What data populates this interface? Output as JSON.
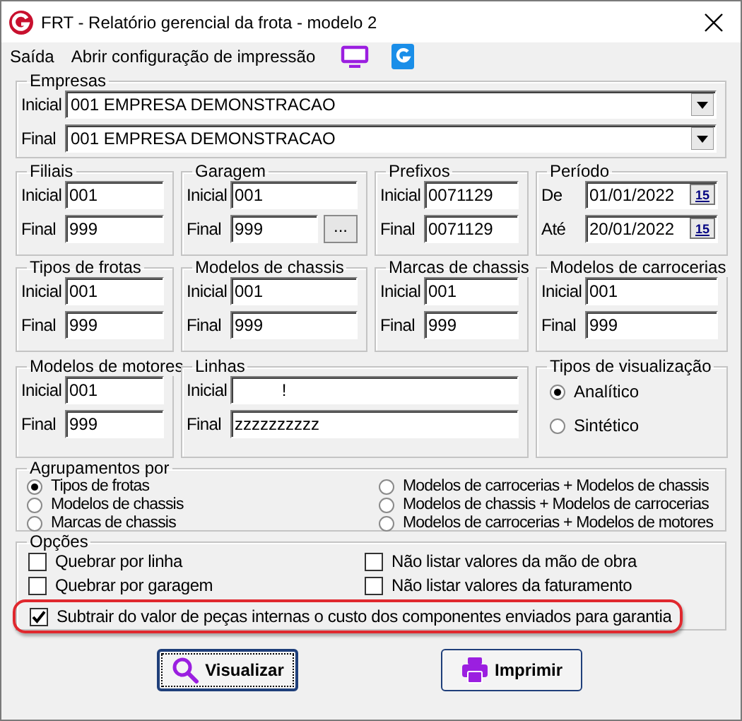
{
  "window": {
    "title": "FRT - Relatório gerencial da frota - modelo 2"
  },
  "menu": [
    {
      "label": "Saída"
    },
    {
      "label": "Abrir configuração de impressão"
    }
  ],
  "empresas": {
    "title": "Empresas",
    "rows": [
      {
        "label": "Inicial",
        "value": "001 EMPRESA DEMONSTRACAO"
      },
      {
        "label": "Final",
        "value": "001 EMPRESA DEMONSTRACAO"
      }
    ]
  },
  "filter_rows": [
    [
      {
        "title": "Filiais",
        "kind": "range",
        "rows": [
          {
            "label": "Inicial",
            "value": "001"
          },
          {
            "label": "Final",
            "value": "999"
          }
        ]
      },
      {
        "title": "Garagem",
        "kind": "range",
        "rows": [
          {
            "label": "Inicial",
            "value": "001"
          },
          {
            "label": "Final",
            "value": "999",
            "button": "..."
          }
        ]
      },
      {
        "title": "Prefixos",
        "kind": "range",
        "rows": [
          {
            "label": "Inicial",
            "value": "0071129"
          },
          {
            "label": "Final",
            "value": "0071129"
          }
        ]
      },
      {
        "title": "Período",
        "kind": "date_range",
        "rows": [
          {
            "label": "De",
            "value": "01/01/2022",
            "button": "15"
          },
          {
            "label": "Até",
            "value": "20/01/2022",
            "button": "15"
          }
        ]
      }
    ],
    [
      {
        "title": "Tipos de frotas",
        "kind": "range",
        "rows": [
          {
            "label": "Inicial",
            "value": "001"
          },
          {
            "label": "Final",
            "value": "999"
          }
        ]
      },
      {
        "title": "Modelos de chassis",
        "kind": "range",
        "rows": [
          {
            "label": "Inicial",
            "value": "001"
          },
          {
            "label": "Final",
            "value": "999"
          }
        ]
      },
      {
        "title": "Marcas de chassis",
        "kind": "range",
        "rows": [
          {
            "label": "Inicial",
            "value": "001"
          },
          {
            "label": "Final",
            "value": "999"
          }
        ]
      },
      {
        "title": "Modelos de carrocerias",
        "kind": "range",
        "rows": [
          {
            "label": "Inicial",
            "value": "001"
          },
          {
            "label": "Final",
            "value": "999"
          }
        ]
      }
    ],
    [
      {
        "title": "Modelos de motores",
        "kind": "range",
        "rows": [
          {
            "label": "Inicial",
            "value": "001"
          },
          {
            "label": "Final",
            "value": "999"
          }
        ]
      },
      {
        "title": "Linhas",
        "kind": "range",
        "rows": [
          {
            "label": "Inicial",
            "value": "          !"
          },
          {
            "label": "Final",
            "value": "zzzzzzzzzz"
          }
        ]
      },
      {
        "title": "Tipos de visualização",
        "kind": "radio",
        "options": [
          {
            "label": "Analítico",
            "selected": true
          },
          {
            "label": "Sintético",
            "selected": false
          }
        ]
      }
    ]
  ],
  "agrupamentos": {
    "title": "Agrupamentos por",
    "options": [
      {
        "label": "Tipos de frotas",
        "selected": true
      },
      {
        "label": "Modelos de chassis",
        "selected": false
      },
      {
        "label": "Marcas de chassis",
        "selected": false
      },
      {
        "label": "Modelos de carrocerias + Modelos de  chassis",
        "selected": false
      },
      {
        "label": "Modelos de chassis + Modelos de carrocerias",
        "selected": false
      },
      {
        "label": "Modelos de carrocerias + Modelos de motores",
        "selected": false
      }
    ]
  },
  "opcoes": {
    "title": "Opções",
    "options": [
      {
        "label": "Quebrar por linha",
        "checked": false,
        "highlighted": false
      },
      {
        "label": "Não listar valores da mão de obra",
        "checked": false,
        "highlighted": false
      },
      {
        "label": "Quebrar por garagem",
        "checked": false,
        "highlighted": false
      },
      {
        "label": "Não listar valores da faturamento",
        "checked": false,
        "highlighted": false
      },
      {
        "label": "Subtrair do valor de peças internas o custo dos componentes enviados para garantia",
        "checked": true,
        "highlighted": true
      }
    ]
  },
  "buttons": [
    {
      "label": "Visualizar",
      "kind": "preview",
      "focused": true
    },
    {
      "label": "Imprimir",
      "kind": "print",
      "focused": false
    }
  ]
}
